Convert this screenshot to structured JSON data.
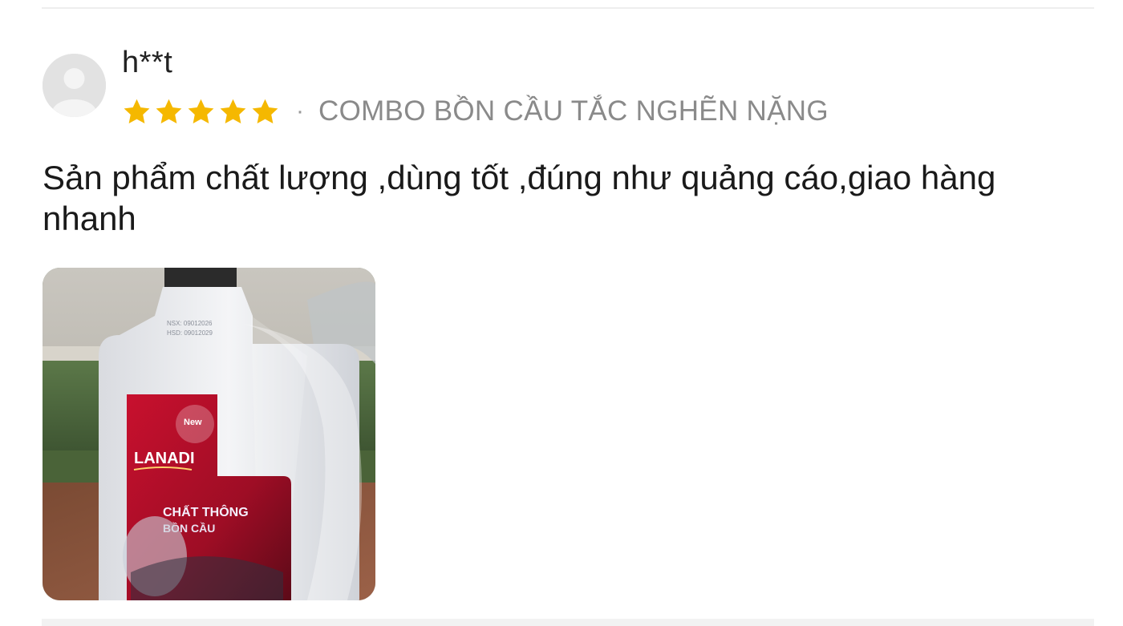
{
  "review": {
    "username": "h**t",
    "rating": 5,
    "rating_max": 5,
    "separator": "·",
    "variant": "COMBO BỒN CẦU TẮC NGHẼN NẶNG",
    "comment": "Sản phẩm chất lượng ,dùng tốt ,đúng như quảng cáo,giao hàng nhanh",
    "photo": {
      "bottle_date_1": "NSX: 09012026",
      "bottle_date_2": "HSD: 09012029",
      "label_badge": "New",
      "label_brand": "LANADI",
      "label_line_1": "CHẤT THÔNG",
      "label_line_2": "BỒN CẦU"
    }
  },
  "colors": {
    "star": "#f5b800",
    "variant_text": "#8a8a8a",
    "comment_text": "#1a1a1a"
  }
}
